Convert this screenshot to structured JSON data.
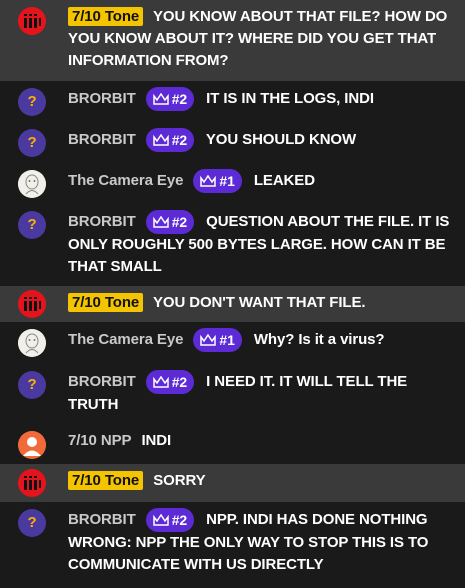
{
  "colors": {
    "background": "#1a1a1a",
    "highlight_row": "#3a3a3a",
    "tone_badge": "#f4c400",
    "rank_badge": "#5c2bd6",
    "bro_avatar": "#4a3aa0",
    "tone_avatar": "#e3141b",
    "npp_avatar": "#f06a3a"
  },
  "messages": [
    {
      "user": "7/10 Tone",
      "text": "YOU KNOW ABOUT THAT FILE? HOW DO YOU KNOW ABOUT IT? WHERE DID YOU GET THAT INFORMATION FROM?"
    },
    {
      "user": "BRORBIT",
      "badge": "#2",
      "text": "IT IS IN THE LOGS, INDI"
    },
    {
      "user": "BRORBIT",
      "badge": "#2",
      "text": "YOU SHOULD KNOW"
    },
    {
      "user": "The Camera Eye",
      "badge": "#1",
      "text": "LEAKED"
    },
    {
      "user": "BRORBIT",
      "badge": "#2",
      "text": "QUESTION ABOUT THE FILE. IT IS ONLY ROUGHLY 500 BYTES LARGE. HOW CAN IT BE THAT SMALL"
    },
    {
      "user": "7/10 Tone",
      "text": "YOU DON'T WANT THAT FILE."
    },
    {
      "user": "The Camera Eye",
      "badge": "#1",
      "text": "Why? Is it a virus?"
    },
    {
      "user": "BRORBIT",
      "badge": "#2",
      "text": "I NEED IT. IT WILL TELL THE TRUTH"
    },
    {
      "user": "7/10 NPP",
      "text": "INDI"
    },
    {
      "user": "7/10 Tone",
      "text": "SORRY"
    },
    {
      "user": "BRORBIT",
      "badge": "#2",
      "text": "NPP. INDI HAS DONE NOTHING WRONG: NPP THE ONLY WAY TO STOP THIS IS TO COMMUNICATE WITH US DIRECTLY"
    }
  ],
  "icons": {
    "tone_avatar": "bars-logo-icon",
    "bro_avatar": "question-mark-icon",
    "bro_avatar_glyph": "?",
    "camera_avatar": "face-sketch-icon",
    "npp_avatar": "person-silhouette-icon",
    "badge": "crown-icon"
  }
}
